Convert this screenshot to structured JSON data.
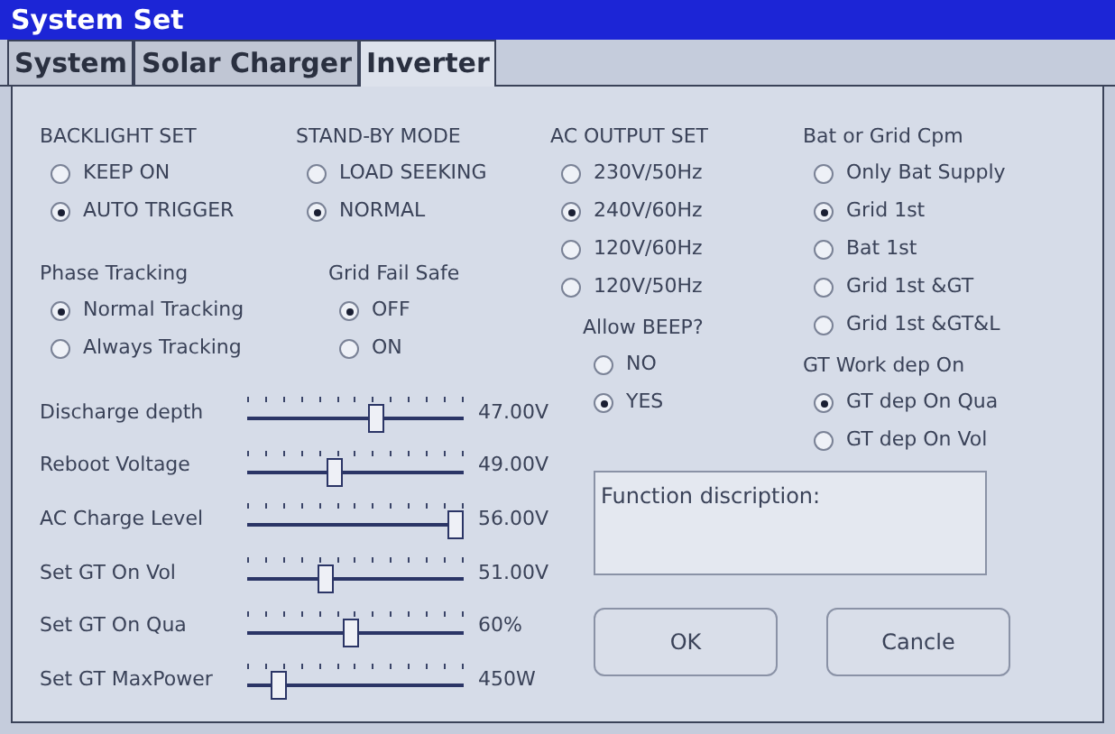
{
  "window": {
    "title": "System Set"
  },
  "tabs": [
    {
      "label": "System",
      "selected": false
    },
    {
      "label": "Solar Charger",
      "selected": false
    },
    {
      "label": "Inverter",
      "selected": true
    }
  ],
  "group_columns": [
    [
      {
        "title": "BACKLIGHT SET",
        "options": [
          {
            "label": "KEEP ON",
            "selected": false
          },
          {
            "label": "AUTO TRIGGER",
            "selected": true
          }
        ]
      },
      {
        "title": "Phase Tracking",
        "options": [
          {
            "label": "Normal Tracking",
            "selected": true
          },
          {
            "label": "Always Tracking",
            "selected": false
          }
        ]
      }
    ],
    [
      {
        "title": "STAND-BY MODE",
        "options": [
          {
            "label": "LOAD SEEKING",
            "selected": false
          },
          {
            "label": "NORMAL",
            "selected": true
          }
        ]
      },
      {
        "title": "Grid Fail Safe",
        "options": [
          {
            "label": "OFF",
            "selected": true
          },
          {
            "label": "ON",
            "selected": false
          }
        ]
      }
    ],
    [
      {
        "title": "AC OUTPUT SET",
        "options": [
          {
            "label": "230V/50Hz",
            "selected": false
          },
          {
            "label": "240V/60Hz",
            "selected": true
          },
          {
            "label": "120V/60Hz",
            "selected": false
          },
          {
            "label": "120V/50Hz",
            "selected": false
          }
        ]
      },
      {
        "title": "Allow BEEP?",
        "options": [
          {
            "label": "NO",
            "selected": false
          },
          {
            "label": "YES",
            "selected": true
          }
        ]
      }
    ],
    [
      {
        "title": "Bat or Grid Cpm",
        "options": [
          {
            "label": "Only Bat Supply",
            "selected": false
          },
          {
            "label": "Grid 1st",
            "selected": true
          },
          {
            "label": "Bat 1st",
            "selected": false
          },
          {
            "label": "Grid 1st &GT",
            "selected": false
          },
          {
            "label": "Grid 1st &GT&L",
            "selected": false
          }
        ]
      },
      {
        "title": "GT Work dep On",
        "options": [
          {
            "label": "GT dep On Qua",
            "selected": true
          },
          {
            "label": "GT dep On Vol",
            "selected": false
          }
        ]
      }
    ]
  ],
  "sliders": [
    {
      "label": "Discharge depth",
      "level": 0.6,
      "reading": "47.00V"
    },
    {
      "label": "Reboot Voltage",
      "level": 0.4,
      "reading": "49.00V"
    },
    {
      "label": "AC Charge Level",
      "level": 1.0,
      "reading": "56.00V"
    },
    {
      "label": "Set GT On Vol",
      "level": 0.35,
      "reading": "51.00V"
    },
    {
      "label": "Set GT On Qua",
      "level": 0.48,
      "reading": "60%"
    },
    {
      "label": "Set GT MaxPower",
      "level": 0.12,
      "reading": "450W"
    }
  ],
  "function_description": {
    "label": "Function discription:"
  },
  "buttons": [
    "OK",
    "Cancle"
  ]
}
